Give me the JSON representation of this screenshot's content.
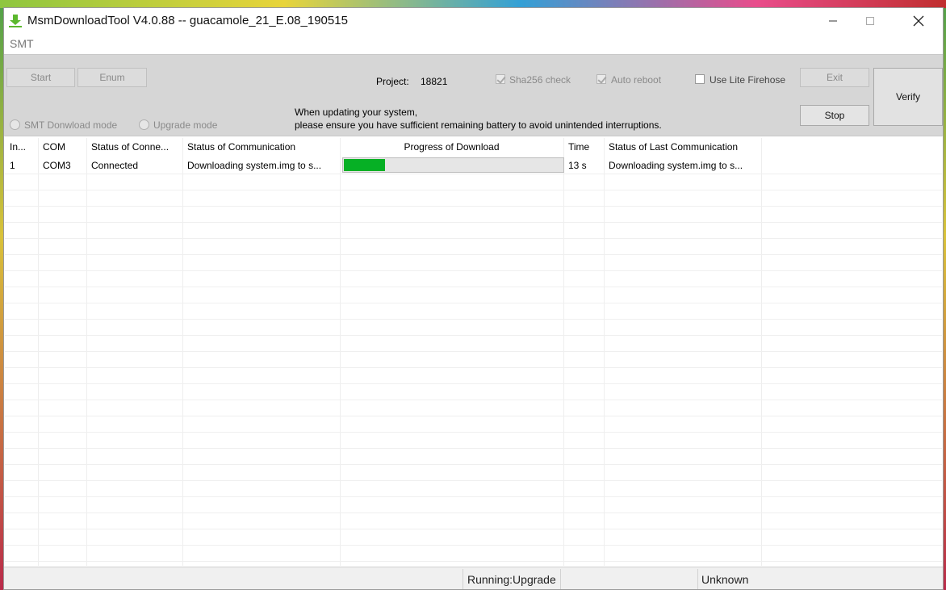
{
  "window": {
    "title": "MsmDownloadTool V4.0.88 -- guacamole_21_E.08_190515",
    "app_icon": "download-arrow-icon",
    "controls": [
      "minimize-icon",
      "maximize-icon",
      "close-icon"
    ]
  },
  "menu": {
    "smt_label": "SMT"
  },
  "toolbar": {
    "start_label": "Start",
    "enum_label": "Enum",
    "project_label": "Project:",
    "project_value": "18821",
    "sha256_label": "Sha256 check",
    "sha256_checked": true,
    "auto_reboot_label": "Auto reboot",
    "auto_reboot_checked": true,
    "lite_firehose_label": "Use Lite Firehose",
    "lite_firehose_checked": false,
    "exit_label": "Exit",
    "stop_label": "Stop",
    "verify_label": "Verify",
    "smt_mode_label": "SMT Donwload mode",
    "upgrade_mode_label": "Upgrade mode",
    "notice_line1": "When updating your system,",
    "notice_line2": "please ensure you have sufficient remaining battery to avoid unintended interruptions."
  },
  "table": {
    "headers": [
      "In...",
      "COM",
      "Status of Conne...",
      "Status of Communication",
      "Progress of Download",
      "Time",
      "Status of Last Communication"
    ],
    "rows": [
      {
        "index": "1",
        "com": "COM3",
        "connection": "Connected",
        "communication": "Downloading system.img to s...",
        "progress": 0.19,
        "time": "13 s",
        "last_communication": "Downloading system.img to s..."
      }
    ]
  },
  "statusbar": {
    "running": "Running:Upgrade",
    "state": "Unknown"
  },
  "colors": {
    "progress_fill": "#06b025",
    "toolbar_bg": "#d6d6d6"
  }
}
